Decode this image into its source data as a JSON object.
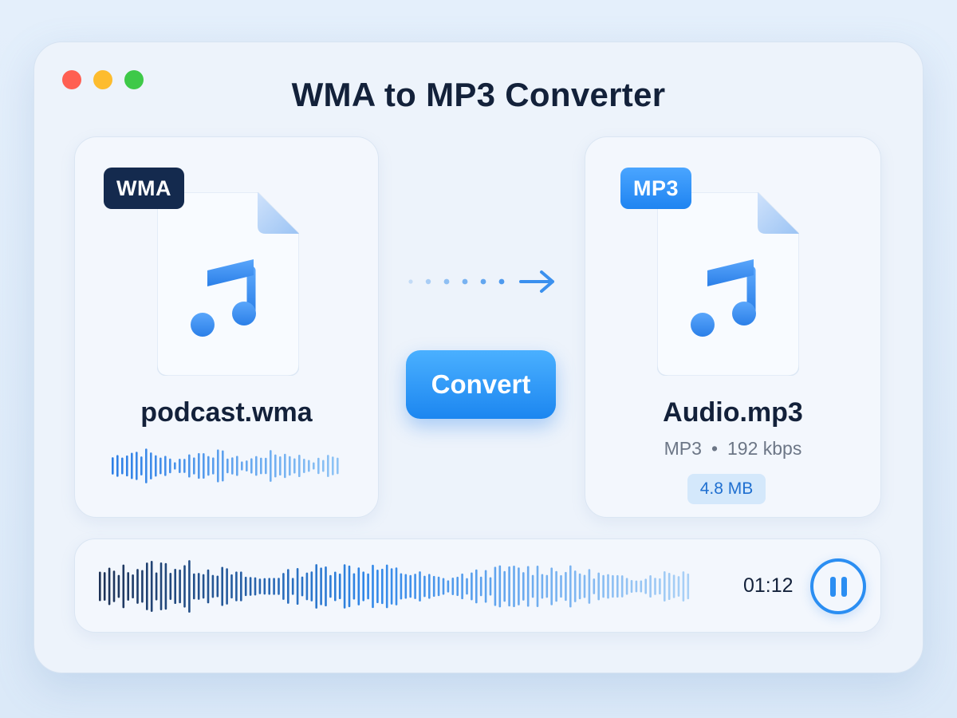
{
  "window": {
    "title": "WMA to MP3 Converter",
    "traffic_lights": [
      "close",
      "minimize",
      "maximize"
    ]
  },
  "source_file": {
    "badge": "WMA",
    "name": "podcast.wma",
    "icon": "music-note-icon"
  },
  "target_file": {
    "badge": "MP3",
    "name": "Audio.mp3",
    "format": "MP3",
    "separator": "•",
    "bitrate": "192 kbps",
    "size": "4.8 MB",
    "icon": "music-note-icon"
  },
  "actions": {
    "convert_label": "Convert"
  },
  "player": {
    "time": "01:12",
    "state": "playing",
    "pause_icon": "pause-icon"
  },
  "colors": {
    "accent": "#2b8ef2",
    "dark": "#13213a",
    "wma_badge": "#142a4e",
    "close": "#ff5f52",
    "minimize": "#fdbc2e",
    "maximize": "#3ec948"
  }
}
